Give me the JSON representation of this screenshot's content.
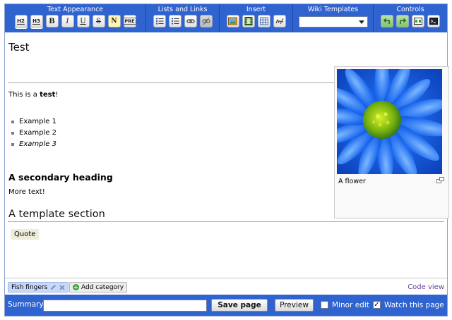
{
  "toolbar": {
    "groups": {
      "text_appearance": "Text Appearance",
      "lists_links": "Lists and Links",
      "insert": "Insert",
      "wiki_templates": "Wiki Templates",
      "controls": "Controls"
    },
    "buttons": {
      "h2": "H2",
      "h3": "H3",
      "bold": "B",
      "italic": "I",
      "underline": "U",
      "strike": "S",
      "nowiki": "N",
      "pre": "PRE"
    },
    "template_select_value": ""
  },
  "page": {
    "title": "Test",
    "intro_prefix": "This is a ",
    "intro_bold": "test",
    "intro_suffix": "!",
    "list_items": [
      "Example 1",
      "Example 2",
      "Example 3"
    ],
    "secondary_heading": "A secondary heading",
    "more_text": "More text!",
    "template_section_heading": "A template section",
    "quote_label": "Quote",
    "image_caption": "A flower"
  },
  "categories": {
    "items": [
      "Fish fingers"
    ],
    "add_label": "Add category",
    "code_view": "Code view"
  },
  "summary": {
    "label": "Summary:",
    "value": "",
    "save_label": "Save page",
    "preview_label": "Preview",
    "minor_edit_label": "Minor edit",
    "minor_edit_checked": false,
    "watch_label": "Watch this page",
    "watch_checked": true
  },
  "colors": {
    "toolbar_bg": "#2f63cf",
    "link_purple": "#6a3d9a",
    "category_bg": "#c8d8f8"
  }
}
